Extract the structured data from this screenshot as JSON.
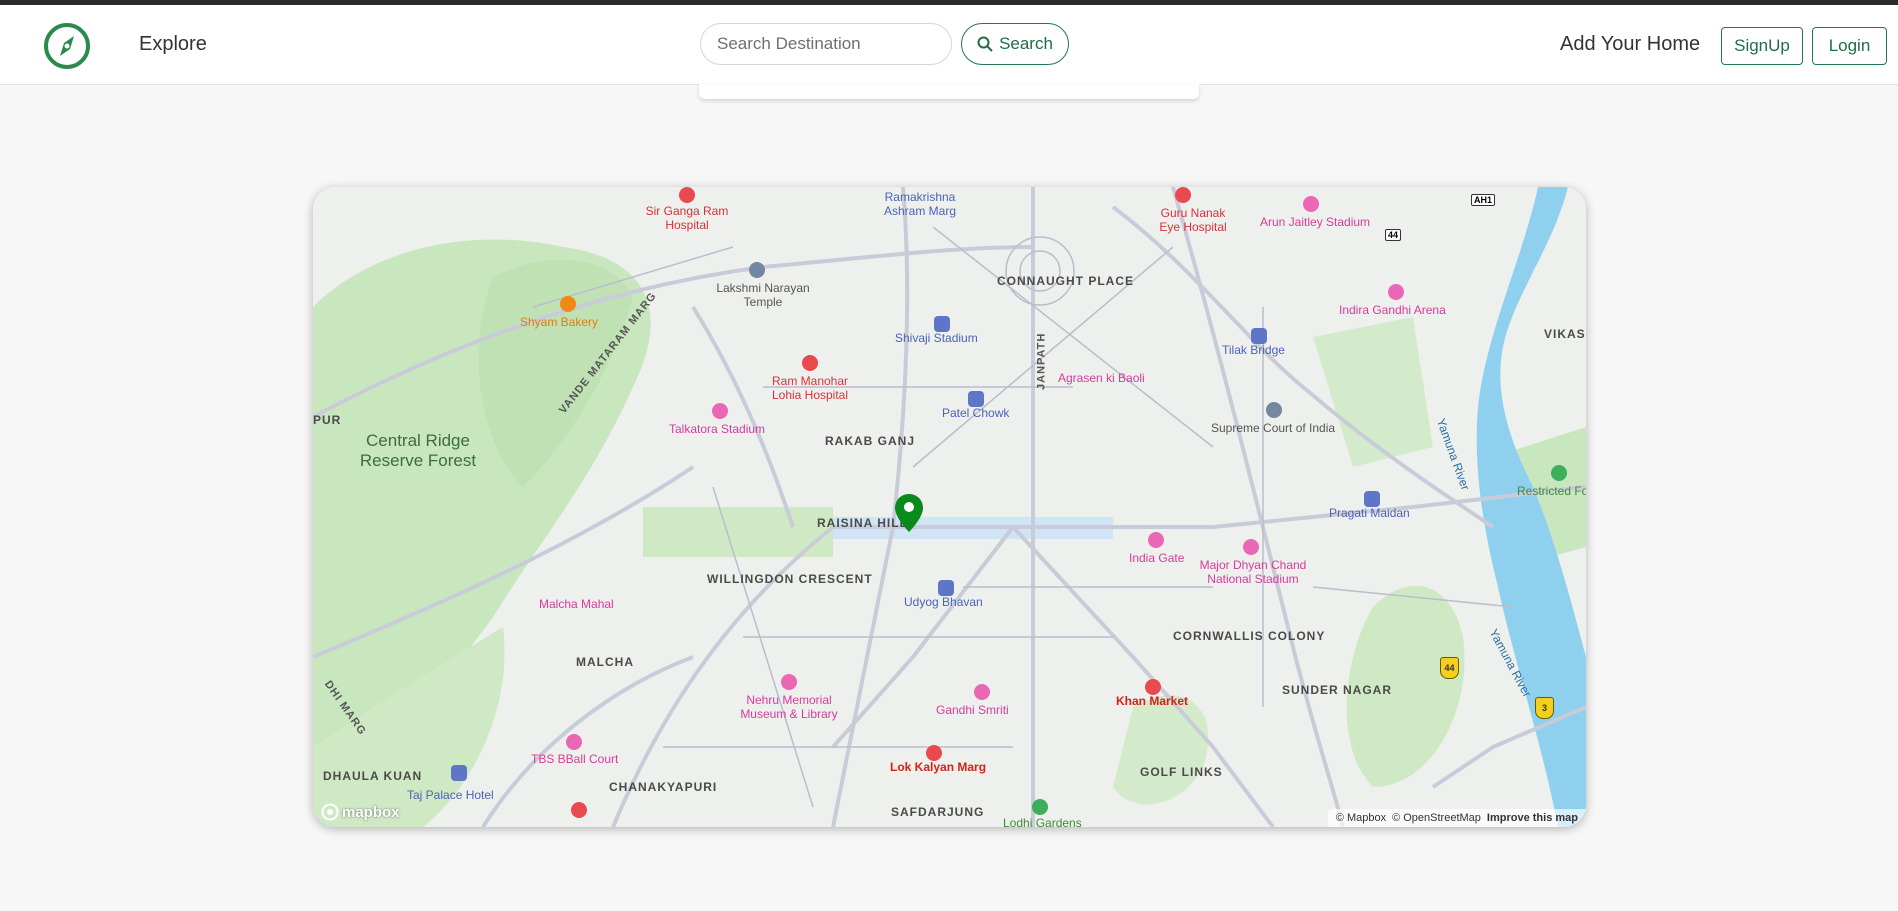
{
  "navbar": {
    "explore_label": "Explore",
    "search": {
      "placeholder": "Search Destination",
      "value": "",
      "button_label": "Search"
    },
    "add_home_label": "Add Your Home",
    "signup_label": "SignUp",
    "login_label": "Login"
  },
  "colors": {
    "brand": "#1f7a4c",
    "marker": "#0a8a1a"
  },
  "map": {
    "areas": [
      "CONNAUGHT PLACE",
      "RAKAB GANJ",
      "RAISINA HILL",
      "WILLINGDON CRESCENT",
      "MALCHA",
      "CHANAKYAPURI",
      "CORNWALLIS COLONY",
      "SUNDER NAGAR",
      "GOLF LINKS",
      "SAFDARJUNG",
      "DHAULA KUAN",
      "PUR",
      "VIKAS"
    ],
    "forest": "Central Ridge Reserve Forest",
    "roads": [
      "VANDE MATARAM MARG",
      "JANPATH",
      "DHI MARG"
    ],
    "pois": {
      "sir_ganga": "Sir Ganga Ram Hospital",
      "ramakrishna": "Ramakrishna Ashram Marg",
      "guru_nanak": "Guru Nanak Eye Hospital",
      "arun_jaitley": "Arun Jaitley Stadium",
      "lakshmi": "Lakshmi Narayan Temple",
      "shyam": "Shyam Bakery",
      "shivaji": "Shivaji Stadium",
      "tilak": "Tilak Bridge",
      "indira": "Indira Gandhi Arena",
      "rml": "Ram Manohar Lohia Hospital",
      "agrasen": "Agrasen ki Baoli",
      "talkatora": "Talkatora Stadium",
      "patel": "Patel Chowk",
      "supreme": "Supreme Court of India",
      "restricted": "Restricted Fore",
      "pragati": "Pragati Maidan",
      "india_gate": "India Gate",
      "dhyan_chand": "Major Dhyan Chand National Stadium",
      "udyog": "Udyog Bhavan",
      "malcha_mahal": "Malcha Mahal",
      "nehru": "Nehru Memorial Museum & Library",
      "gandhi": "Gandhi Smriti",
      "khan": "Khan Market",
      "tbs": "TBS BBall Court",
      "lok_kalyan": "Lok Kalyan Marg",
      "taj": "Taj Palace Hotel",
      "lodhi": "Lodhi Gardens"
    },
    "river": "Yamuna River",
    "shields": [
      "44",
      "3",
      "AH1",
      "44"
    ],
    "attribution": {
      "mapbox": "© Mapbox",
      "osm": "© OpenStreetMap",
      "improve": "Improve this map"
    },
    "logo_text": "mapbox"
  }
}
